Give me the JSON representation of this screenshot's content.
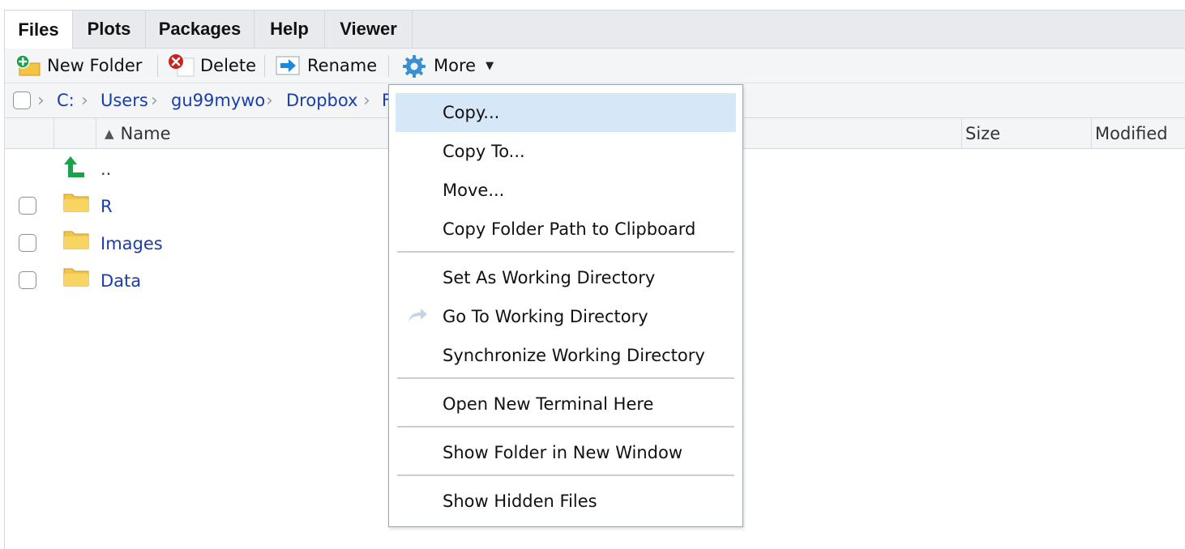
{
  "tabs": [
    {
      "label": "Files",
      "active": true
    },
    {
      "label": "Plots",
      "active": false
    },
    {
      "label": "Packages",
      "active": false
    },
    {
      "label": "Help",
      "active": false
    },
    {
      "label": "Viewer",
      "active": false
    }
  ],
  "toolbar": {
    "new_folder": "New Folder",
    "delete": "Delete",
    "rename": "Rename",
    "more": "More"
  },
  "breadcrumb": [
    "C:",
    "Users",
    "gu99mywo",
    "Dropbox",
    "F"
  ],
  "columns": {
    "name": "Name",
    "size": "Size",
    "modified": "Modified"
  },
  "files": [
    {
      "name": "..",
      "type": "parent"
    },
    {
      "name": "R",
      "type": "folder"
    },
    {
      "name": "Images",
      "type": "folder"
    },
    {
      "name": "Data",
      "type": "folder"
    }
  ],
  "menu": {
    "items": [
      {
        "label": "Copy...",
        "highlighted": true
      },
      {
        "label": "Copy To..."
      },
      {
        "label": "Move..."
      },
      {
        "label": "Copy Folder Path to Clipboard"
      },
      {
        "label": "Set As Working Directory"
      },
      {
        "label": "Go To Working Directory",
        "icon": "goto-arrow-icon"
      },
      {
        "label": "Synchronize Working Directory"
      },
      {
        "label": "Open New Terminal Here"
      },
      {
        "label": "Show Folder in New Window"
      },
      {
        "label": "Show Hidden Files"
      }
    ]
  },
  "colors": {
    "link": "#1a3ea8",
    "highlight": "#d6e8f7",
    "folder": "#f4c542",
    "parent_arrow": "#1aa34a"
  }
}
